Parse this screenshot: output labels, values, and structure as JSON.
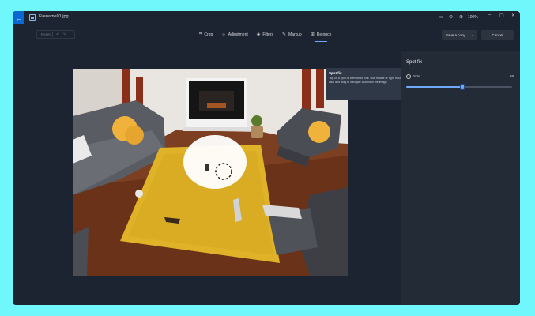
{
  "titlebar": {
    "back_icon": "back-arrow-icon",
    "file_name": "Filename01.jpg",
    "zoom": "100%",
    "icons": [
      "frame-icon",
      "zoom-out-icon",
      "zoom-in-icon"
    ],
    "window_controls": [
      "minimize-icon",
      "maximize-icon",
      "close-icon"
    ]
  },
  "toolbar": {
    "reset_label": "Reset",
    "tools": [
      {
        "label": "Crop",
        "icon": "crop-icon",
        "active": false
      },
      {
        "label": "Adjustment",
        "icon": "sun-icon",
        "active": false
      },
      {
        "label": "Filters",
        "icon": "filter-icon",
        "active": false
      },
      {
        "label": "Markup",
        "icon": "pen-icon",
        "active": false
      },
      {
        "label": "Retouch",
        "icon": "retouch-icon",
        "active": true
      }
    ],
    "save_label": "Save a copy",
    "cancel_label": "Cancel"
  },
  "tooltip": {
    "title": "Spot fix",
    "body": "Tap on a spot or blemish to fix it. Use middle or right mouse click and drag to navigate around in the image."
  },
  "panel": {
    "title": "Spot fix",
    "size_label": "Size",
    "size_value": "68",
    "size_fraction": 0.53
  },
  "colors": {
    "accent": "#6ea8ff",
    "back_button": "#0a68d0",
    "window_bg": "#1c2431",
    "panel_bg": "#232b37",
    "page_bg": "#6ff7fb"
  }
}
